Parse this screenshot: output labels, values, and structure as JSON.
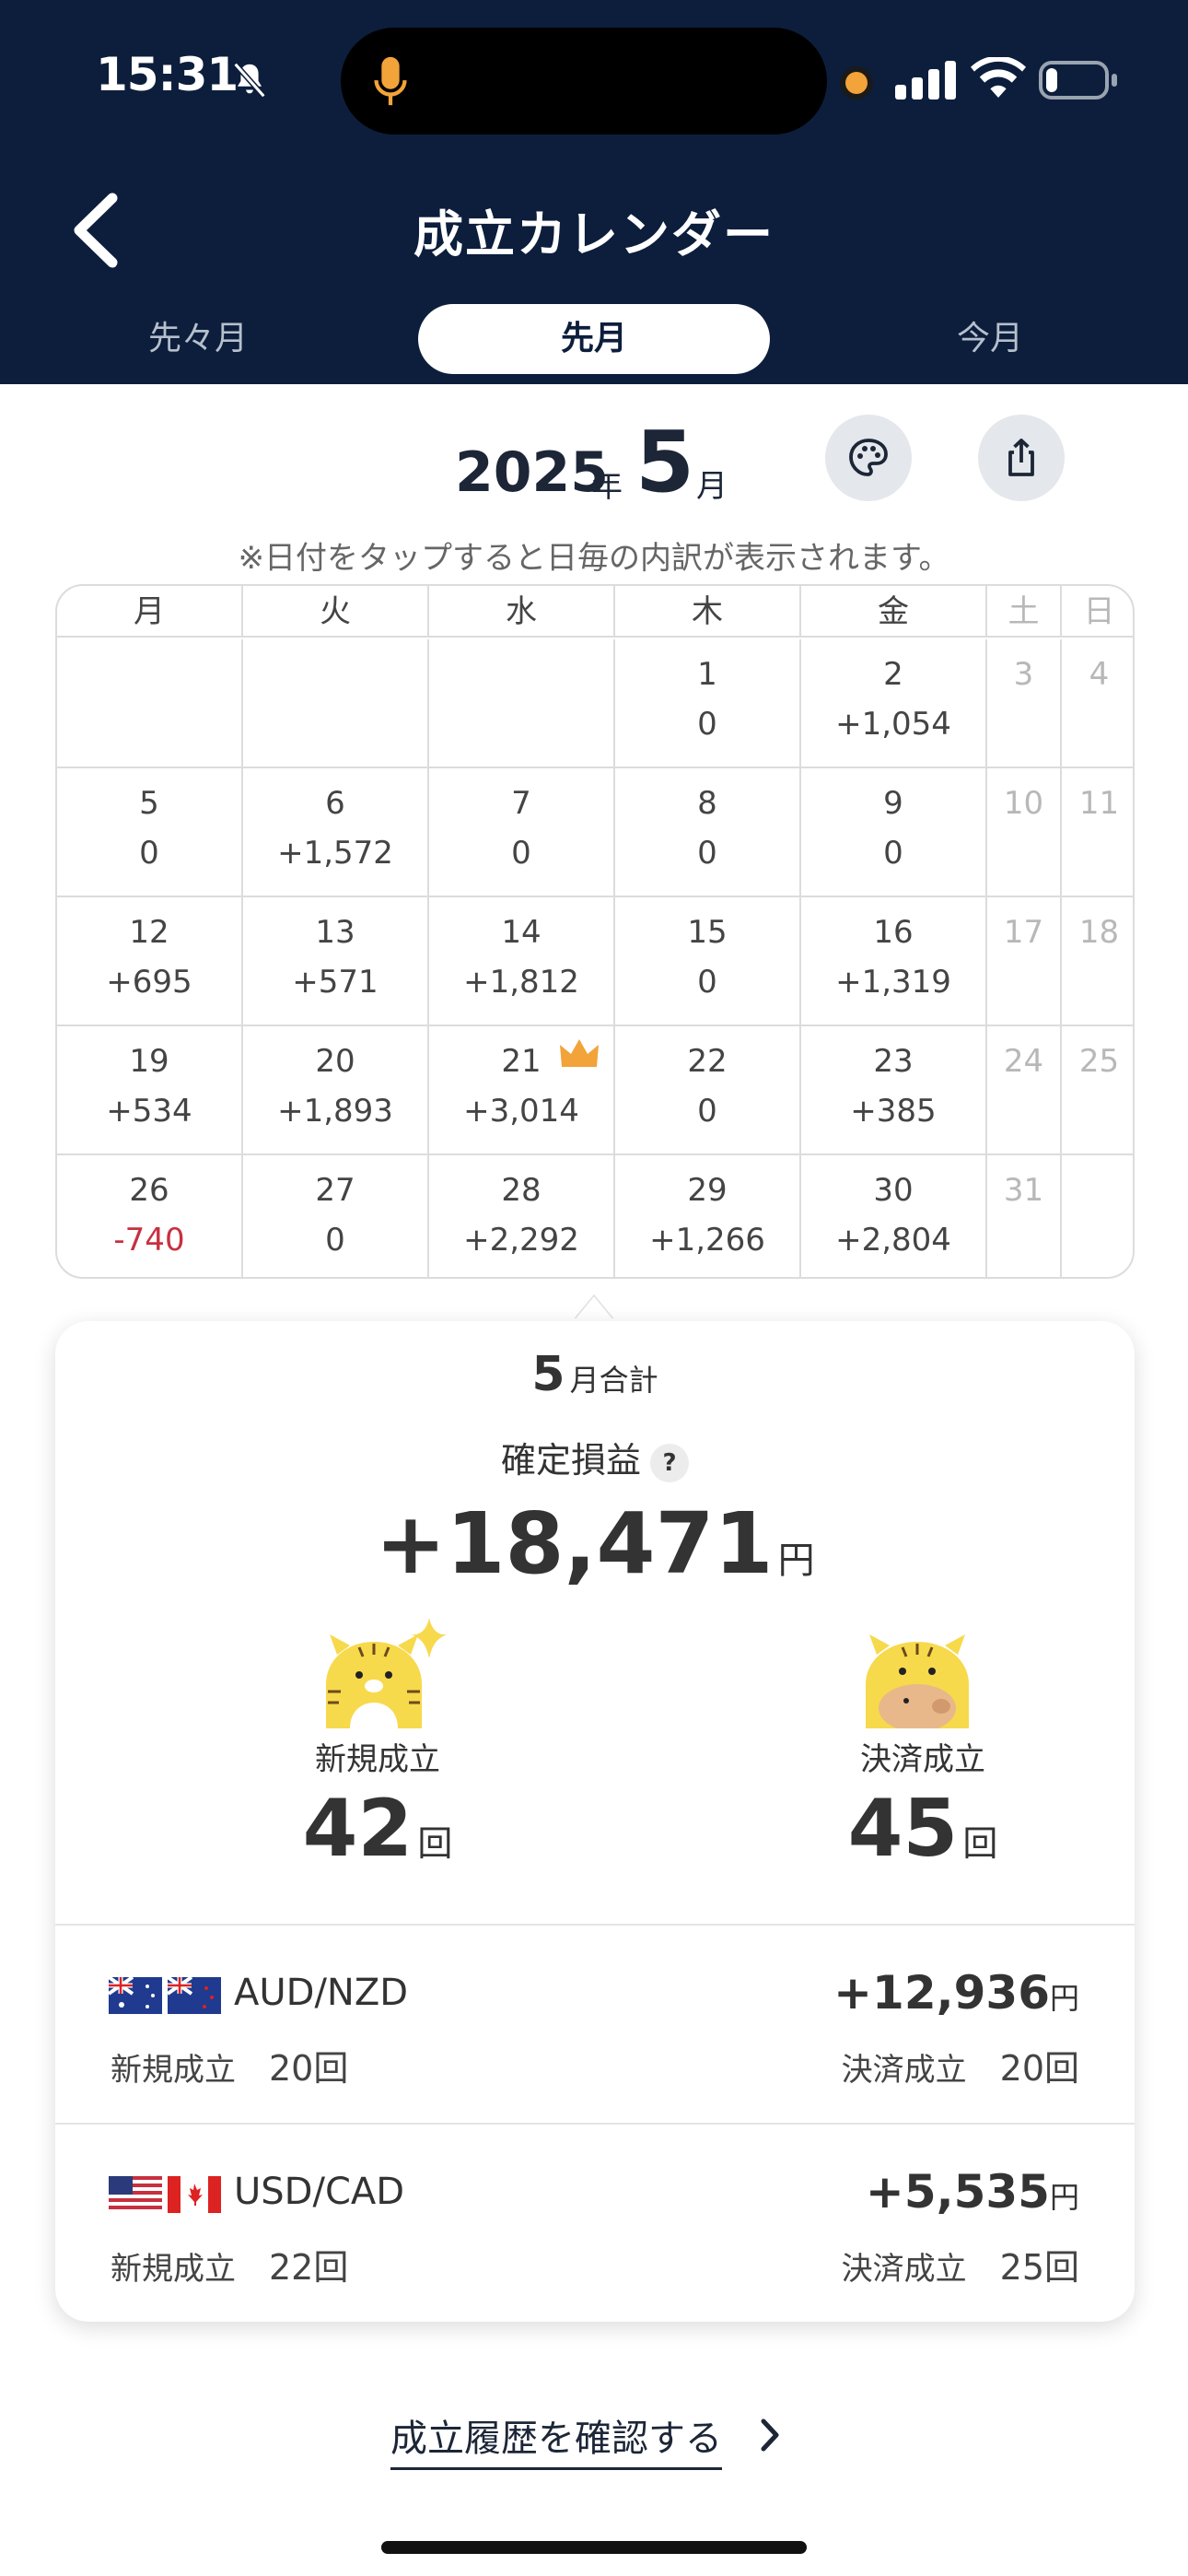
{
  "status_bar": {
    "time": "15:31"
  },
  "nav": {
    "title": "成立カレンダー"
  },
  "tabs": [
    {
      "label": "先々月",
      "active": false
    },
    {
      "label": "先月",
      "active": true
    },
    {
      "label": "今月",
      "active": false
    }
  ],
  "month_header": {
    "year": "2025",
    "year_unit": "年",
    "month": "5",
    "month_unit": "月"
  },
  "hint": "※日付をタップすると日毎の内訳が表示されます。",
  "calendar": {
    "weekdays": [
      "月",
      "火",
      "水",
      "木",
      "金",
      "土",
      "日"
    ],
    "rows": [
      [
        {
          "d": "",
          "v": ""
        },
        {
          "d": "",
          "v": ""
        },
        {
          "d": "",
          "v": ""
        },
        {
          "d": "1",
          "v": "0"
        },
        {
          "d": "2",
          "v": "+1,054"
        },
        {
          "d": "3",
          "v": ""
        },
        {
          "d": "4",
          "v": ""
        }
      ],
      [
        {
          "d": "5",
          "v": "0"
        },
        {
          "d": "6",
          "v": "+1,572"
        },
        {
          "d": "7",
          "v": "0"
        },
        {
          "d": "8",
          "v": "0"
        },
        {
          "d": "9",
          "v": "0"
        },
        {
          "d": "10",
          "v": ""
        },
        {
          "d": "11",
          "v": ""
        }
      ],
      [
        {
          "d": "12",
          "v": "+695"
        },
        {
          "d": "13",
          "v": "+571"
        },
        {
          "d": "14",
          "v": "+1,812"
        },
        {
          "d": "15",
          "v": "0"
        },
        {
          "d": "16",
          "v": "+1,319"
        },
        {
          "d": "17",
          "v": ""
        },
        {
          "d": "18",
          "v": ""
        }
      ],
      [
        {
          "d": "19",
          "v": "+534"
        },
        {
          "d": "20",
          "v": "+1,893"
        },
        {
          "d": "21",
          "v": "+3,014"
        },
        {
          "d": "22",
          "v": "0"
        },
        {
          "d": "23",
          "v": "+385"
        },
        {
          "d": "24",
          "v": ""
        },
        {
          "d": "25",
          "v": ""
        }
      ],
      [
        {
          "d": "26",
          "v": "-740"
        },
        {
          "d": "27",
          "v": "0"
        },
        {
          "d": "28",
          "v": "+2,292"
        },
        {
          "d": "29",
          "v": "+1,266"
        },
        {
          "d": "30",
          "v": "+2,804"
        },
        {
          "d": "31",
          "v": ""
        },
        {
          "d": "",
          "v": ""
        }
      ]
    ]
  },
  "summary": {
    "month": "5",
    "month_label": "月合計",
    "pl_label": "確定損益",
    "help": "?",
    "total": "+18,471",
    "currency": "円",
    "new_label": "新規成立",
    "new_count": "42",
    "close_label": "決済成立",
    "close_count": "45",
    "count_unit": "回"
  },
  "pairs": [
    {
      "name": "AUD/NZD",
      "pl": "+12,936",
      "unit": "円",
      "new_label": "新規成立",
      "new_count": "20回",
      "close_label": "決済成立",
      "close_count": "20回"
    },
    {
      "name": "USD/CAD",
      "pl": "+5,535",
      "unit": "円",
      "new_label": "新規成立",
      "new_count": "22回",
      "close_label": "決済成立",
      "close_count": "25回"
    }
  ],
  "history_link": "成立履歴を確認する",
  "colors": {
    "header_bg": "#0c1e3c",
    "negative": "#c8303f",
    "crown": "#f2a33a"
  }
}
